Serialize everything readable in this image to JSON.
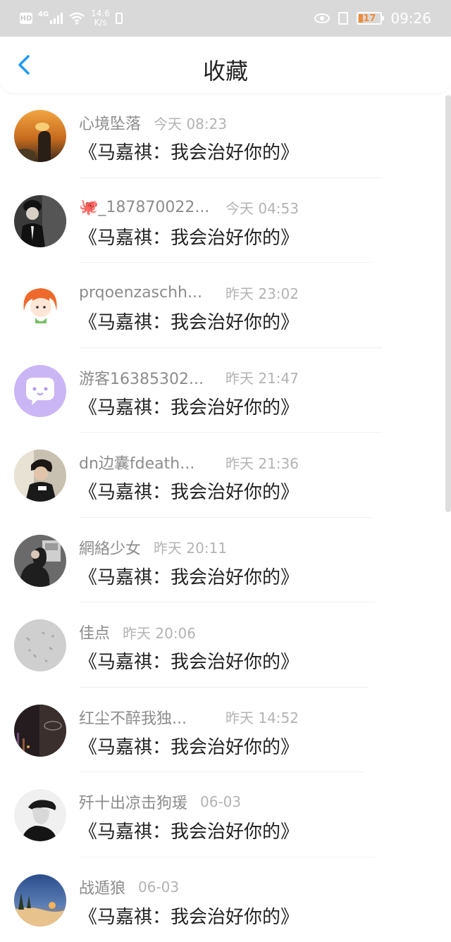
{
  "status_bar": {
    "hd": "HD",
    "network": "4G",
    "speed_value": "14.6",
    "speed_unit": "K/s",
    "battery": "17",
    "time": "09:26",
    "battery_color": "#f08a3a"
  },
  "header": {
    "title": "收藏",
    "back_icon": "chevron-left-icon",
    "accent_color": "#1e9bf0"
  },
  "items": [
    {
      "name": "心境坠落",
      "time": "今天 08:23",
      "message": "《马嘉祺：我会治好你的》",
      "truncated": false
    },
    {
      "name": "🐙_187870022...",
      "time": "今天 04:53",
      "message": "《马嘉祺：我会治好你的》",
      "truncated": true
    },
    {
      "name": "prqoenzaschh...",
      "time": "昨天 23:02",
      "message": "《马嘉祺：我会治好你的》",
      "truncated": true
    },
    {
      "name": "游客16385302...",
      "time": "昨天 21:47",
      "message": "《马嘉祺：我会治好你的》",
      "truncated": true
    },
    {
      "name": "dn边囊fdeath...",
      "time": "昨天 21:36",
      "message": "《马嘉祺：我会治好你的》",
      "truncated": true
    },
    {
      "name": "網絡少女",
      "time": "昨天 20:11",
      "message": "《马嘉祺：我会治好你的》",
      "truncated": false
    },
    {
      "name": "佳点",
      "time": "昨天 20:06",
      "message": "《马嘉祺：我会治好你的》",
      "truncated": false
    },
    {
      "name": "红尘不醉我独...",
      "time": "昨天 14:52",
      "message": "《马嘉祺：我会治好你的》",
      "truncated": true
    },
    {
      "name": "歼十出凉击狗瑗",
      "time": "06-03",
      "message": "《马嘉祺：我会治好你的》",
      "truncated": false
    },
    {
      "name": "战遁狼",
      "time": "06-03",
      "message": "《马嘉祺：我会治好你的》",
      "truncated": false
    }
  ]
}
